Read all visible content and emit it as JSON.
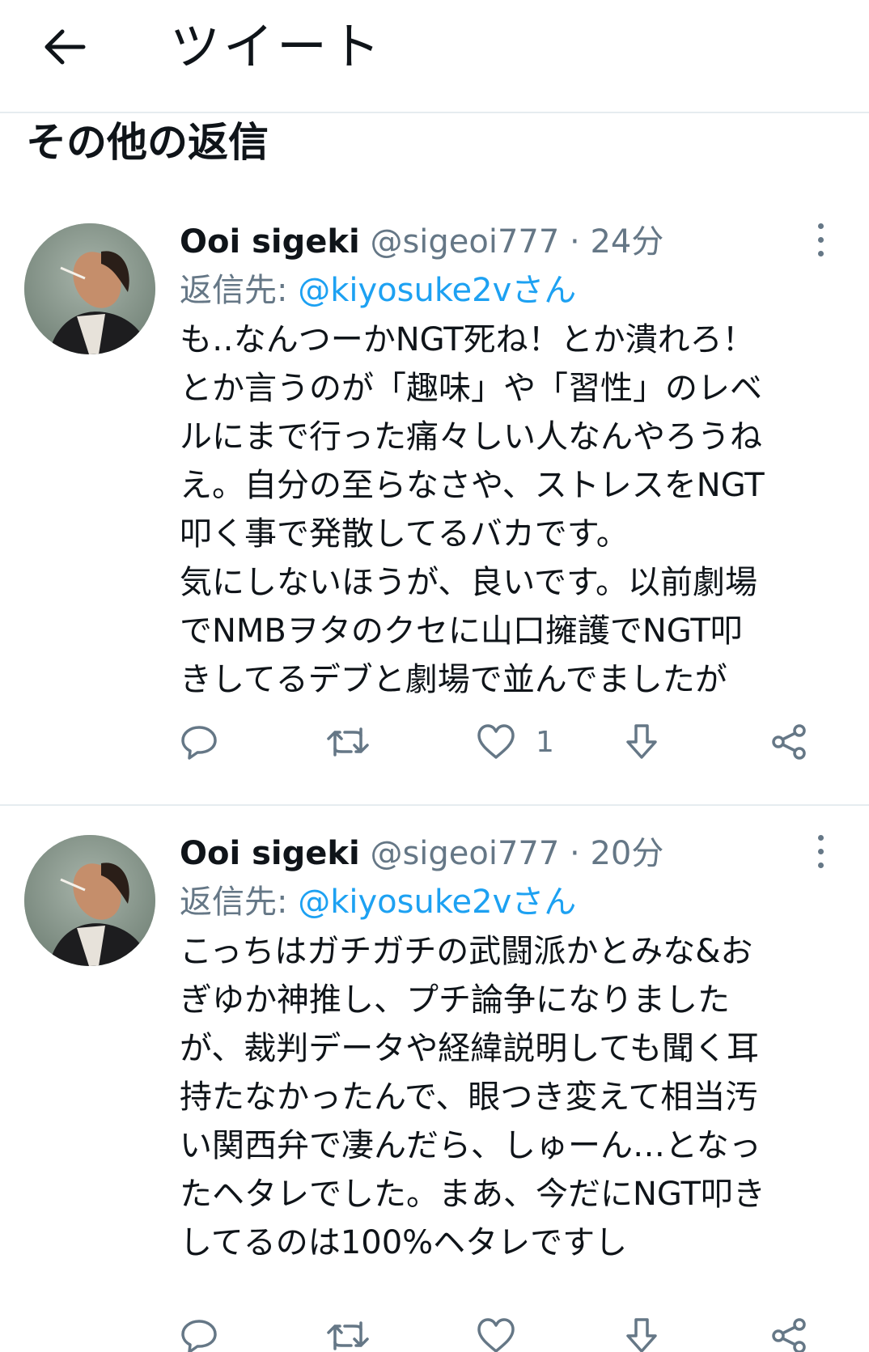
{
  "header": {
    "title": "ツイート"
  },
  "section": {
    "title": "その他の返信"
  },
  "tweets": [
    {
      "name": "Ooi sigeki",
      "handle": "@sigeoi777",
      "separator": " · ",
      "time": "24分",
      "reply_prefix": "返信先: ",
      "reply_to": "@kiyosuke2vさん",
      "lines": [
        "も‥なんつーかNGT死ね！とか潰れろ！",
        "とか言うのが「趣味」や「習性」のレベ",
        "ルにまで行った痛々しい人なんやろうね",
        "え。自分の至らなさや、ストレスをNGT",
        "叩く事で発散してるバカです。",
        "気にしないほうが、良いです。以前劇場",
        "でNMBヲタのクセに山口擁護でNGT叩",
        "きしてるデブと劇場で並んでましたが"
      ],
      "like_count": "1"
    },
    {
      "name": "Ooi sigeki",
      "handle": "@sigeoi777",
      "separator": " · ",
      "time": "20分",
      "reply_prefix": "返信先: ",
      "reply_to": "@kiyosuke2vさん",
      "lines": [
        "こっちはガチガチの武闘派かとみな&お",
        "ぎゆか神推し、プチ論争になりました",
        "が、裁判データや経緯説明しても聞く耳",
        "持たなかったんで、眼つき変えて相当汚",
        "い関西弁で凄んだら、しゅーん…となっ",
        "たヘタレでした。まあ、今だにNGT叩き",
        "してるのは100%ヘタレですし"
      ],
      "like_count": ""
    }
  ],
  "icons": {
    "back": "arrow-left-icon",
    "more": "more-vertical-icon",
    "reply": "reply-bubble-icon",
    "retweet": "retweet-icon",
    "like": "heart-icon",
    "save": "download-arrow-icon",
    "share": "share-icon"
  },
  "colors": {
    "text": "#0f1419",
    "secondary": "#657786",
    "link": "#1da1f2",
    "divider": "#e6ecf0"
  }
}
